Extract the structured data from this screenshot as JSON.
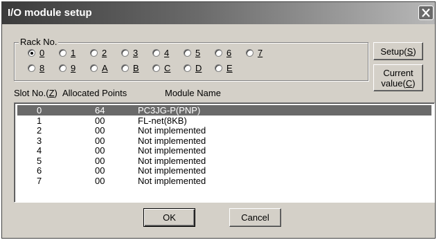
{
  "window": {
    "title": "I/O module setup"
  },
  "rack": {
    "legend": "Rack No.",
    "options": [
      "0",
      "1",
      "2",
      "3",
      "4",
      "5",
      "6",
      "7",
      "8",
      "9",
      "A",
      "B",
      "C",
      "D",
      "E"
    ],
    "selected": "0"
  },
  "buttons": {
    "setup_label": "Setup(",
    "setup_key": "S",
    "setup_close": ")",
    "current_line1": "Current",
    "current_label": "value(",
    "current_key": "C",
    "current_close": ")",
    "ok": "OK",
    "cancel": "Cancel"
  },
  "columns": {
    "slot": "Slot No.(",
    "slot_key": "Z",
    "slot_close": ")",
    "points": "Allocated Points",
    "name": "Module Name"
  },
  "rows": [
    {
      "slot": "0",
      "points": "64",
      "name": "PC3JG-P(PNP)",
      "selected": true
    },
    {
      "slot": "1",
      "points": "00",
      "name": "FL-net(8KB)"
    },
    {
      "slot": "2",
      "points": "00",
      "name": "Not implemented"
    },
    {
      "slot": "3",
      "points": "00",
      "name": "Not implemented"
    },
    {
      "slot": "4",
      "points": "00",
      "name": "Not implemented"
    },
    {
      "slot": "5",
      "points": "00",
      "name": "Not implemented"
    },
    {
      "slot": "6",
      "points": "00",
      "name": "Not implemented"
    },
    {
      "slot": "7",
      "points": "00",
      "name": "Not implemented"
    }
  ],
  "colors": {
    "selection": "#6a6a6a",
    "dialog_bg": "#d4d0c8"
  },
  "icons": {
    "close": "close-icon"
  }
}
